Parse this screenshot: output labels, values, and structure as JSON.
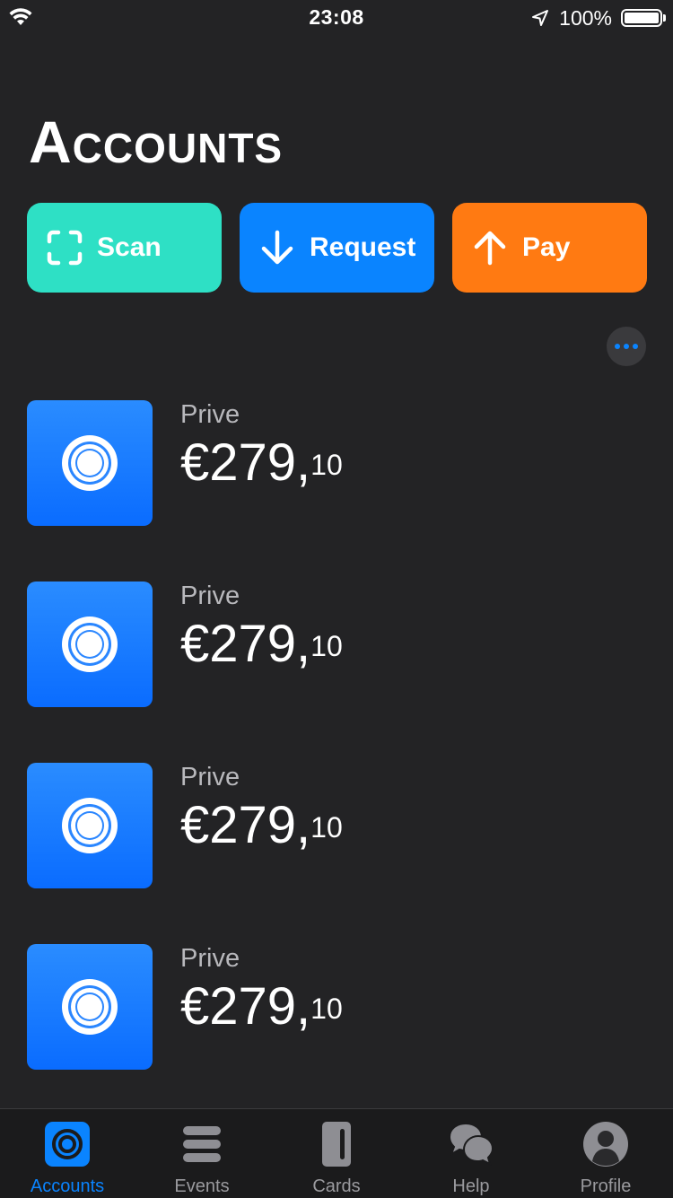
{
  "status_bar": {
    "time": "23:08",
    "battery_percent": "100%",
    "battery_level": 1.0
  },
  "page": {
    "title": "Accounts"
  },
  "actions": {
    "scan": "Scan",
    "request": "Request",
    "pay": "Pay"
  },
  "colors": {
    "scan": "#2ee0c5",
    "request": "#0a84ff",
    "pay": "#ff7a12",
    "accent": "#0a84ff",
    "background": "#232325"
  },
  "accounts": [
    {
      "name": "Prive",
      "amount_main": "€279,",
      "amount_cents": "10",
      "icon": "account-ring-icon"
    },
    {
      "name": "Prive",
      "amount_main": "€279,",
      "amount_cents": "10",
      "icon": "account-ring-icon"
    },
    {
      "name": "Prive",
      "amount_main": "€279,",
      "amount_cents": "10",
      "icon": "account-ring-icon"
    },
    {
      "name": "Prive",
      "amount_main": "€279,",
      "amount_cents": "10",
      "icon": "account-ring-icon"
    }
  ],
  "tabs": [
    {
      "label": "Accounts",
      "icon": "accounts-icon",
      "active": true
    },
    {
      "label": "Events",
      "icon": "events-icon",
      "active": false
    },
    {
      "label": "Cards",
      "icon": "cards-icon",
      "active": false
    },
    {
      "label": "Help",
      "icon": "help-icon",
      "active": false
    },
    {
      "label": "Profile",
      "icon": "profile-icon",
      "active": false
    }
  ]
}
